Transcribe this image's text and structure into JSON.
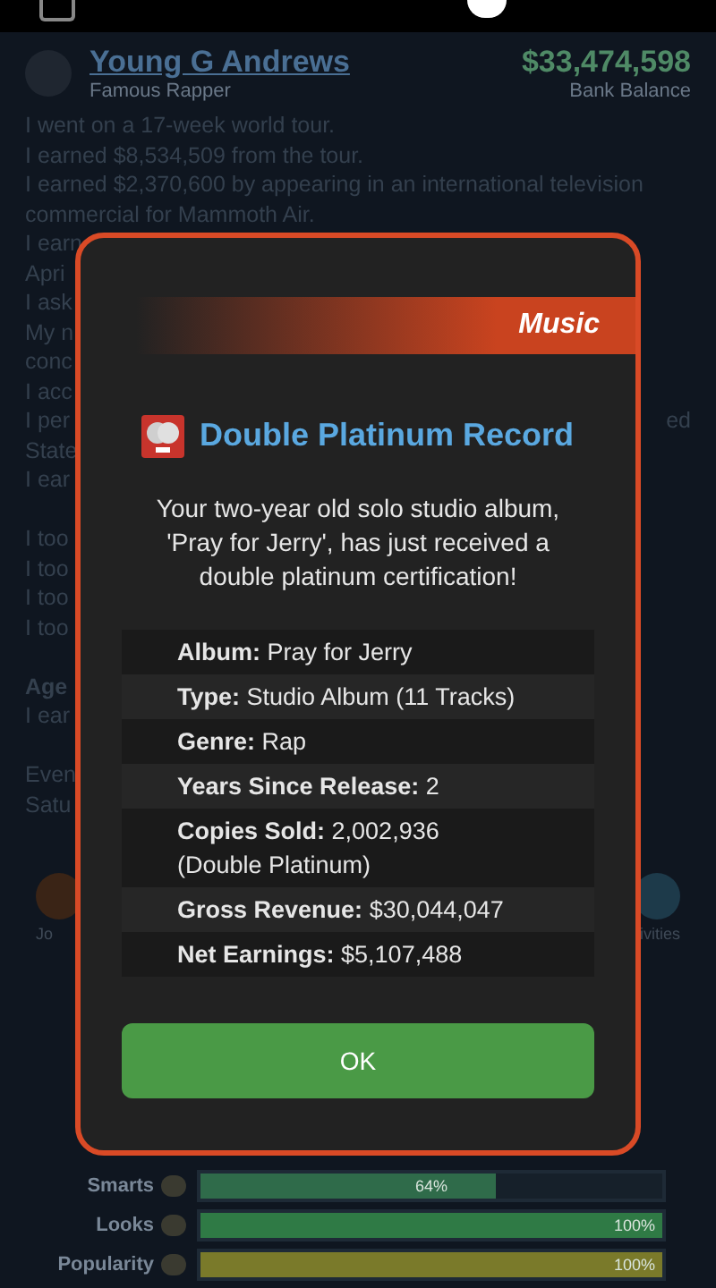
{
  "profile": {
    "name": "Young G Andrews",
    "title": "Famous Rapper",
    "balance": "$33,474,598",
    "balance_label": "Bank Balance"
  },
  "log": [
    {
      "kind": "full",
      "text": "I went on a 17-week world tour."
    },
    {
      "kind": "full",
      "text": "I earned $8,534,509 from the tour."
    },
    {
      "kind": "full",
      "text": "I earned $2,370,600 by appearing in an international television"
    },
    {
      "kind": "full",
      "text": "commercial for Mammoth Air."
    },
    {
      "kind": "cut",
      "text": "I earn"
    },
    {
      "kind": "cut",
      "text": "Apri"
    },
    {
      "kind": "cut",
      "text": "I ask"
    },
    {
      "kind": "cut",
      "text": "My n"
    },
    {
      "kind": "cut",
      "text": "conc"
    },
    {
      "kind": "cut",
      "text": "I acc"
    },
    {
      "kind": "cut",
      "text": "I per",
      "tail": "ed"
    },
    {
      "kind": "cut",
      "text": "State"
    },
    {
      "kind": "cut",
      "text": "I ear"
    },
    {
      "kind": "gap"
    },
    {
      "kind": "cut",
      "text": "I too"
    },
    {
      "kind": "cut",
      "text": "I too"
    },
    {
      "kind": "cut",
      "text": "I too"
    },
    {
      "kind": "cut",
      "text": "I too"
    },
    {
      "kind": "gap"
    },
    {
      "kind": "heading",
      "text": "Age"
    },
    {
      "kind": "cut",
      "text": "I ear"
    },
    {
      "kind": "gap"
    },
    {
      "kind": "cut",
      "text": "Even"
    },
    {
      "kind": "cut",
      "text": "Satu"
    }
  ],
  "nav": {
    "left": "Jo",
    "right": "ivities"
  },
  "stats": [
    {
      "label": "Smarts",
      "level": 0.64,
      "reading": "64%",
      "color": "#2f6b4a"
    },
    {
      "label": "Looks",
      "level": 1,
      "reading": "100%",
      "color": "#2f7a45"
    },
    {
      "label": "Popularity",
      "level": 1,
      "reading": "100%",
      "color": "#7a7a2a"
    }
  ],
  "dialog": {
    "category": "Music",
    "title": "Double Platinum Record",
    "message": "Your two-year old solo studio album, 'Pray for Jerry', has just received a double platinum certification!",
    "details": [
      {
        "label": "Album:",
        "value": "Pray for Jerry"
      },
      {
        "label": "Type:",
        "value": "Studio Album (11 Tracks)"
      },
      {
        "label": "Genre:",
        "value": "Rap"
      },
      {
        "label": "Years Since Release:",
        "value": "2"
      },
      {
        "label": "Copies Sold:",
        "value": "2,002,936",
        "note": "(Double Platinum)"
      },
      {
        "label": "Gross Revenue:",
        "value": "$30,044,047"
      },
      {
        "label": "Net Earnings:",
        "value": "$5,107,488"
      }
    ],
    "button": "OK"
  }
}
